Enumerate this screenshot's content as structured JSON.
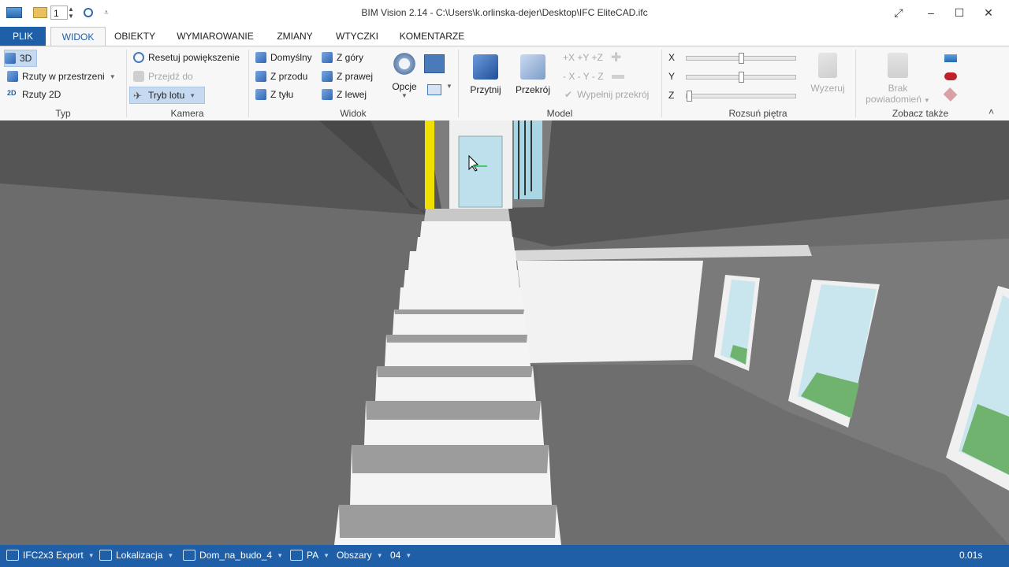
{
  "window": {
    "title": "BIM Vision 2.14 - C:\\Users\\k.orlinska-dejer\\Desktop\\IFC EliteCAD.ifc",
    "quick_access": {
      "spin_value": "1"
    },
    "controls": {
      "minimize": "–",
      "maximize": "☐",
      "close": "✕",
      "restore": "⤢"
    }
  },
  "tabs": [
    {
      "label": "PLIK"
    },
    {
      "label": "WIDOK"
    },
    {
      "label": "OBIEKTY"
    },
    {
      "label": "WYMIAROWANIE"
    },
    {
      "label": "ZMIANY"
    },
    {
      "label": "WTYCZKI"
    },
    {
      "label": "KOMENTARZE"
    }
  ],
  "ribbon": {
    "typ": {
      "label": "Typ",
      "items": [
        "3D",
        "Rzuty w przestrzeni",
        "Rzuty 2D"
      ]
    },
    "kamera": {
      "label": "Kamera",
      "items": [
        "Resetuj powiększenie",
        "Przejdź do",
        "Tryb lotu"
      ]
    },
    "widok": {
      "label": "Widok",
      "items": [
        "Domyślny",
        "Z góry",
        "Z przodu",
        "Z prawej",
        "Z tyłu",
        "Z lewej"
      ],
      "options_label": "Opcje"
    },
    "model": {
      "label": "Model",
      "przytnij": "Przytnij",
      "przekroj": "Przekrój",
      "plus_axes": "+X  +Y  +Z",
      "minus_axes": "- X  - Y  - Z",
      "fill_label": "Wypełnij przekrój"
    },
    "rozsun": {
      "label": "Rozsuń piętra",
      "x": "X",
      "y": "Y",
      "z": "Z",
      "reset_label": "Wyzeruj",
      "x_level": 0.5,
      "y_level": 0.5,
      "z_level": 0.0
    },
    "zobacz": {
      "label": "Zobacz także",
      "notif_line1": "Brak",
      "notif_line2": "powiadomień"
    },
    "collapse": "˄"
  },
  "status": {
    "items": [
      "IFC2x3 Export",
      "Lokalizacja",
      "Dom_na_budo_4",
      "PA",
      "Obszary",
      "04"
    ],
    "time": "0.01s"
  },
  "colors": {
    "accent": "#1e5fa8",
    "ribbon_bg": "#f7f7f7",
    "selected": "#c5d9f1"
  }
}
